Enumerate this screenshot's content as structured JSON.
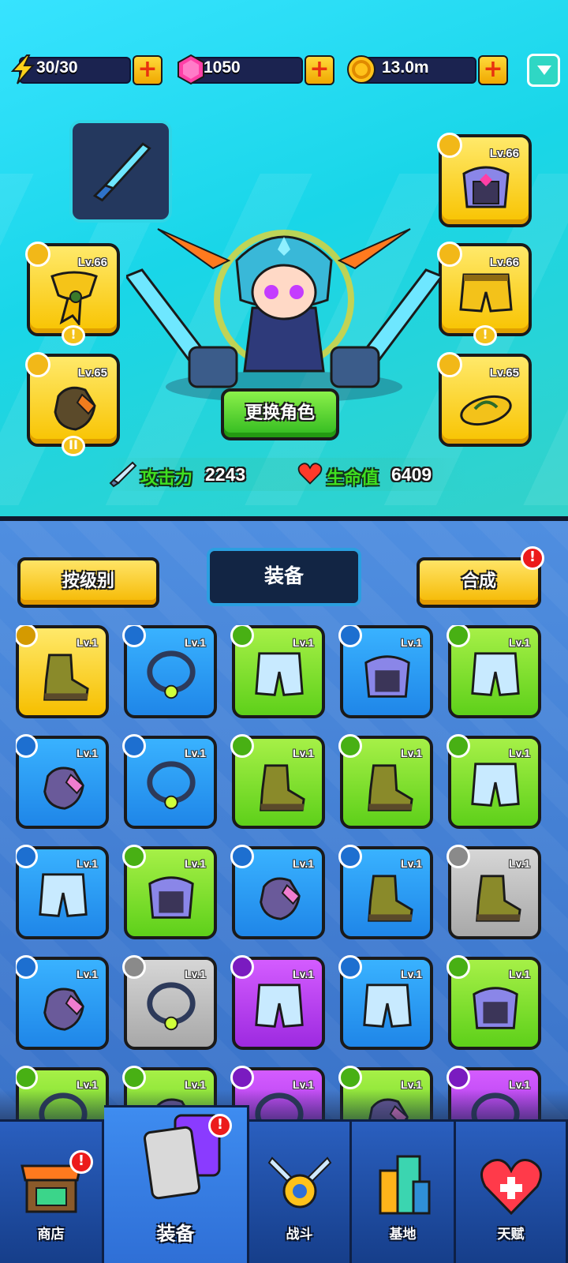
{
  "resources": {
    "energy": "30/30",
    "gems": "1050",
    "coins": "13.0m"
  },
  "equipped": {
    "slots": [
      {
        "lv": "Lv.66",
        "type": "necklace"
      },
      {
        "lv": "Lv.65",
        "type": "glove"
      },
      {
        "lv": "Lv.66",
        "type": "armor"
      },
      {
        "lv": "Lv.66",
        "type": "pants"
      },
      {
        "lv": "Lv.65",
        "type": "boots"
      }
    ]
  },
  "change_character": "更换角色",
  "stats": {
    "attack_label": "攻击力",
    "attack_value": "2243",
    "hp_label": "生命值",
    "hp_value": "6409"
  },
  "inventory": {
    "sort_label": "按级别",
    "title": "装备",
    "merge_label": "合成",
    "merge_alert": "!",
    "items": [
      {
        "lv": "Lv.1",
        "rarity": "yellow",
        "type": "boots"
      },
      {
        "lv": "Lv.1",
        "rarity": "blue",
        "type": "necklace"
      },
      {
        "lv": "Lv.1",
        "rarity": "green",
        "type": "pants"
      },
      {
        "lv": "Lv.1",
        "rarity": "blue",
        "type": "armor"
      },
      {
        "lv": "Lv.1",
        "rarity": "green",
        "type": "pants"
      },
      {
        "lv": "Lv.1",
        "rarity": "blue",
        "type": "glove"
      },
      {
        "lv": "Lv.1",
        "rarity": "blue",
        "type": "necklace"
      },
      {
        "lv": "Lv.1",
        "rarity": "green",
        "type": "boots"
      },
      {
        "lv": "Lv.1",
        "rarity": "green",
        "type": "boots"
      },
      {
        "lv": "Lv.1",
        "rarity": "green",
        "type": "pants"
      },
      {
        "lv": "Lv.1",
        "rarity": "blue",
        "type": "pants"
      },
      {
        "lv": "Lv.1",
        "rarity": "green",
        "type": "armor"
      },
      {
        "lv": "Lv.1",
        "rarity": "blue",
        "type": "glove"
      },
      {
        "lv": "Lv.1",
        "rarity": "blue",
        "type": "boots"
      },
      {
        "lv": "Lv.1",
        "rarity": "gray",
        "type": "boots"
      },
      {
        "lv": "Lv.1",
        "rarity": "blue",
        "type": "glove"
      },
      {
        "lv": "Lv.1",
        "rarity": "gray",
        "type": "necklace"
      },
      {
        "lv": "Lv.1",
        "rarity": "purple",
        "type": "pants"
      },
      {
        "lv": "Lv.1",
        "rarity": "blue",
        "type": "pants"
      },
      {
        "lv": "Lv.1",
        "rarity": "green",
        "type": "armor"
      },
      {
        "lv": "Lv.1",
        "rarity": "green",
        "type": "necklace"
      },
      {
        "lv": "Lv.1",
        "rarity": "green",
        "type": "glove"
      },
      {
        "lv": "Lv.1",
        "rarity": "purple",
        "type": "necklace"
      },
      {
        "lv": "Lv.1",
        "rarity": "green",
        "type": "glove"
      },
      {
        "lv": "Lv.1",
        "rarity": "purple",
        "type": "necklace"
      }
    ]
  },
  "nav": {
    "shop": "商店",
    "equipment": "装备",
    "battle": "战斗",
    "base": "基地",
    "talent": "天赋",
    "alert": "!"
  }
}
